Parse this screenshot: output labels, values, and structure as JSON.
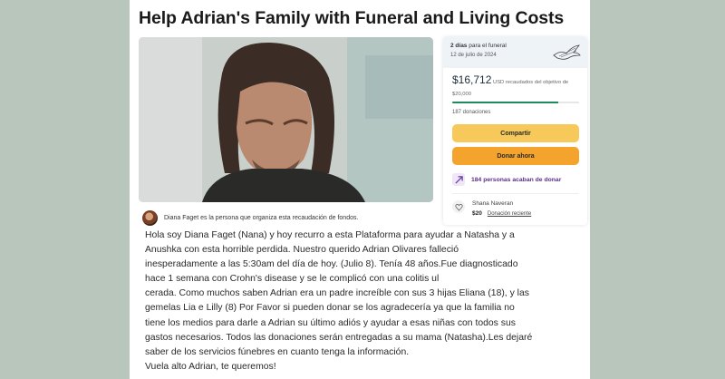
{
  "campaign": {
    "title": "Help Adrian's Family with Funeral and Living Costs"
  },
  "organizer": {
    "text": "Diana Faget es la persona que organiza esta recaudación de fondos."
  },
  "story": {
    "lines": [
      "Hola soy Diana Faget (Nana) y hoy recurro a esta Plataforma para ayudar a Natasha y a",
      "Anushka con esta horrible perdida. Nuestro querido Adrian Olivares falleció",
      "inesperadamente a las 5:30am del día de hoy. (Julio 8). Tenía 48 años.Fue diagnosticado",
      "hace 1 semana con Crohn's disease y se le complicó con una colitis ul",
      "cerada. Como muchos saben Adrian era un padre increíble con sus 3 hijas Eliana (18), y las",
      "gemelas Lia e Lilly (8) Por Favor si pueden donar se los agradecería ya que la familia no",
      "tiene los medios para darle a Adrian su último adiós y ayudar a esas niñas con todos sus",
      "gastos necesarios. Todos las donaciones serán entregadas a su mama (Natasha).Les dejaré",
      "saber de los servicios fúnebres en cuanto tenga la información.",
      "Vuela alto Adrian, te queremos!"
    ]
  },
  "sidebar": {
    "days_strong": "2 días",
    "days_rest": " para el funeral",
    "date": "12 de julio de 2024",
    "amount": "$16,712",
    "amount_suffix": " USD recaudados del objetivo de",
    "goal": "$20,000",
    "progress_fraction": 0.8356,
    "donations": "187 donaciones",
    "share_label": "Compartir",
    "donate_label": "Donar ahora",
    "recent_label": "184 personas acaban de donar",
    "donor_name": "Shana Naveran",
    "donor_amount": "$20",
    "donor_link": "Donación reciente"
  },
  "colors": {
    "share": "#f7c95a",
    "donate": "#f4a42c",
    "progress": "#1f8a5b",
    "recent": "#5a2f88"
  }
}
